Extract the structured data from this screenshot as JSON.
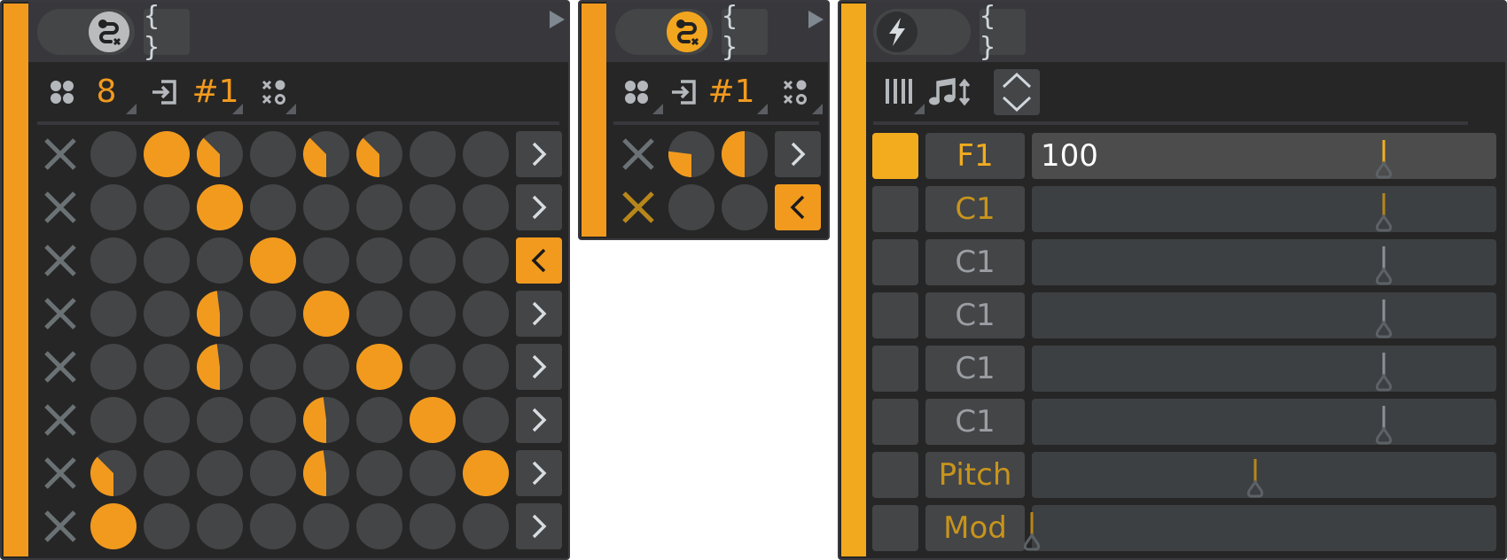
{
  "colors": {
    "accent": "#f29a1e",
    "accent_gold": "#f2ac1e",
    "accent_dim": "#c08a1a",
    "panel_bg": "#262626",
    "header_bg": "#38383c",
    "cell_off": "#434547",
    "icon_grey": "#b4b8bc",
    "x_grey": "#6b7275"
  },
  "panel1": {
    "header": {
      "toggle_icon": "path-x-icon",
      "toggle_state": "off",
      "braces_label": "{ }",
      "play_icon": "play-icon"
    },
    "toolbar": {
      "dice_icon": "dice-icon",
      "count_value": "8",
      "input_icon": "input-icon",
      "channel_value": "#1",
      "pattern_icon": "pattern-icon"
    },
    "grid": {
      "rows": [
        {
          "muted": false,
          "cells": [
            0,
            1,
            0.375,
            0,
            0.375,
            0.375,
            0,
            0
          ],
          "direction": "right"
        },
        {
          "muted": false,
          "cells": [
            0,
            0,
            1,
            0,
            0,
            0,
            0,
            0
          ],
          "direction": "right"
        },
        {
          "muted": false,
          "cells": [
            0,
            0,
            0,
            1,
            0,
            0,
            0,
            0
          ],
          "direction": "left"
        },
        {
          "muted": false,
          "cells": [
            0,
            0,
            0.48,
            0,
            1,
            0,
            0,
            0
          ],
          "direction": "right"
        },
        {
          "muted": false,
          "cells": [
            0,
            0,
            0.48,
            0,
            0,
            1,
            0,
            0
          ],
          "direction": "right"
        },
        {
          "muted": false,
          "cells": [
            0,
            0,
            0,
            0,
            0.48,
            0,
            1,
            0
          ],
          "direction": "right"
        },
        {
          "muted": false,
          "cells": [
            0.375,
            0,
            0,
            0,
            0.48,
            0,
            0,
            1
          ],
          "direction": "right"
        },
        {
          "muted": false,
          "cells": [
            1,
            0,
            0,
            0,
            0,
            0,
            0,
            0
          ],
          "direction": "right"
        }
      ]
    }
  },
  "panel2": {
    "header": {
      "toggle_icon": "path-x-icon",
      "toggle_state": "on",
      "braces_label": "{ }",
      "play_icon": "play-icon"
    },
    "toolbar": {
      "dice_icon": "dice-icon",
      "input_icon": "input-icon",
      "channel_value": "#1",
      "pattern_icon": "pattern-icon"
    },
    "grid": {
      "rows": [
        {
          "muted": false,
          "cells": [
            0.27,
            0.5
          ],
          "direction": "right"
        },
        {
          "muted": true,
          "cells": [
            0,
            0
          ],
          "direction": "left"
        }
      ]
    }
  },
  "panel3": {
    "header": {
      "toggle_icon": "lightning-icon",
      "toggle_state": "off",
      "braces_label": "{ }",
      "play_icon": "play-icon"
    },
    "toolbar": {
      "piano_icon": "piano-icon",
      "note_icon": "note-updown-icon",
      "updown_icon": "chevron-updown-icon"
    },
    "rows": [
      {
        "active": true,
        "label": "F1",
        "label_color": "accent_gold",
        "value_text": "100",
        "value": 0.787,
        "mark_color": "#f2b01e",
        "highlight": true
      },
      {
        "active": false,
        "label": "C1",
        "label_color": "accent_dim",
        "value_text": "",
        "value": 0.787,
        "mark_color": "#b8861a",
        "highlight": false
      },
      {
        "active": false,
        "label": "C1",
        "label_color": "grey",
        "value_text": "",
        "value": 0.787,
        "mark_color": "#8a9196",
        "highlight": false
      },
      {
        "active": false,
        "label": "C1",
        "label_color": "grey",
        "value_text": "",
        "value": 0.787,
        "mark_color": "#8a9196",
        "highlight": false
      },
      {
        "active": false,
        "label": "C1",
        "label_color": "grey",
        "value_text": "",
        "value": 0.787,
        "mark_color": "#8a9196",
        "highlight": false
      },
      {
        "active": false,
        "label": "C1",
        "label_color": "grey",
        "value_text": "",
        "value": 0.787,
        "mark_color": "#8a9196",
        "highlight": false
      },
      {
        "active": false,
        "label": "Pitch",
        "label_color": "accent_dim",
        "value_text": "",
        "value": 0.5,
        "mark_color": "#b8861a",
        "highlight": false
      },
      {
        "active": false,
        "label": "Mod",
        "label_color": "accent_dim",
        "value_text": "",
        "value": 0.0,
        "mark_color": "#b8861a",
        "highlight": false
      }
    ]
  }
}
